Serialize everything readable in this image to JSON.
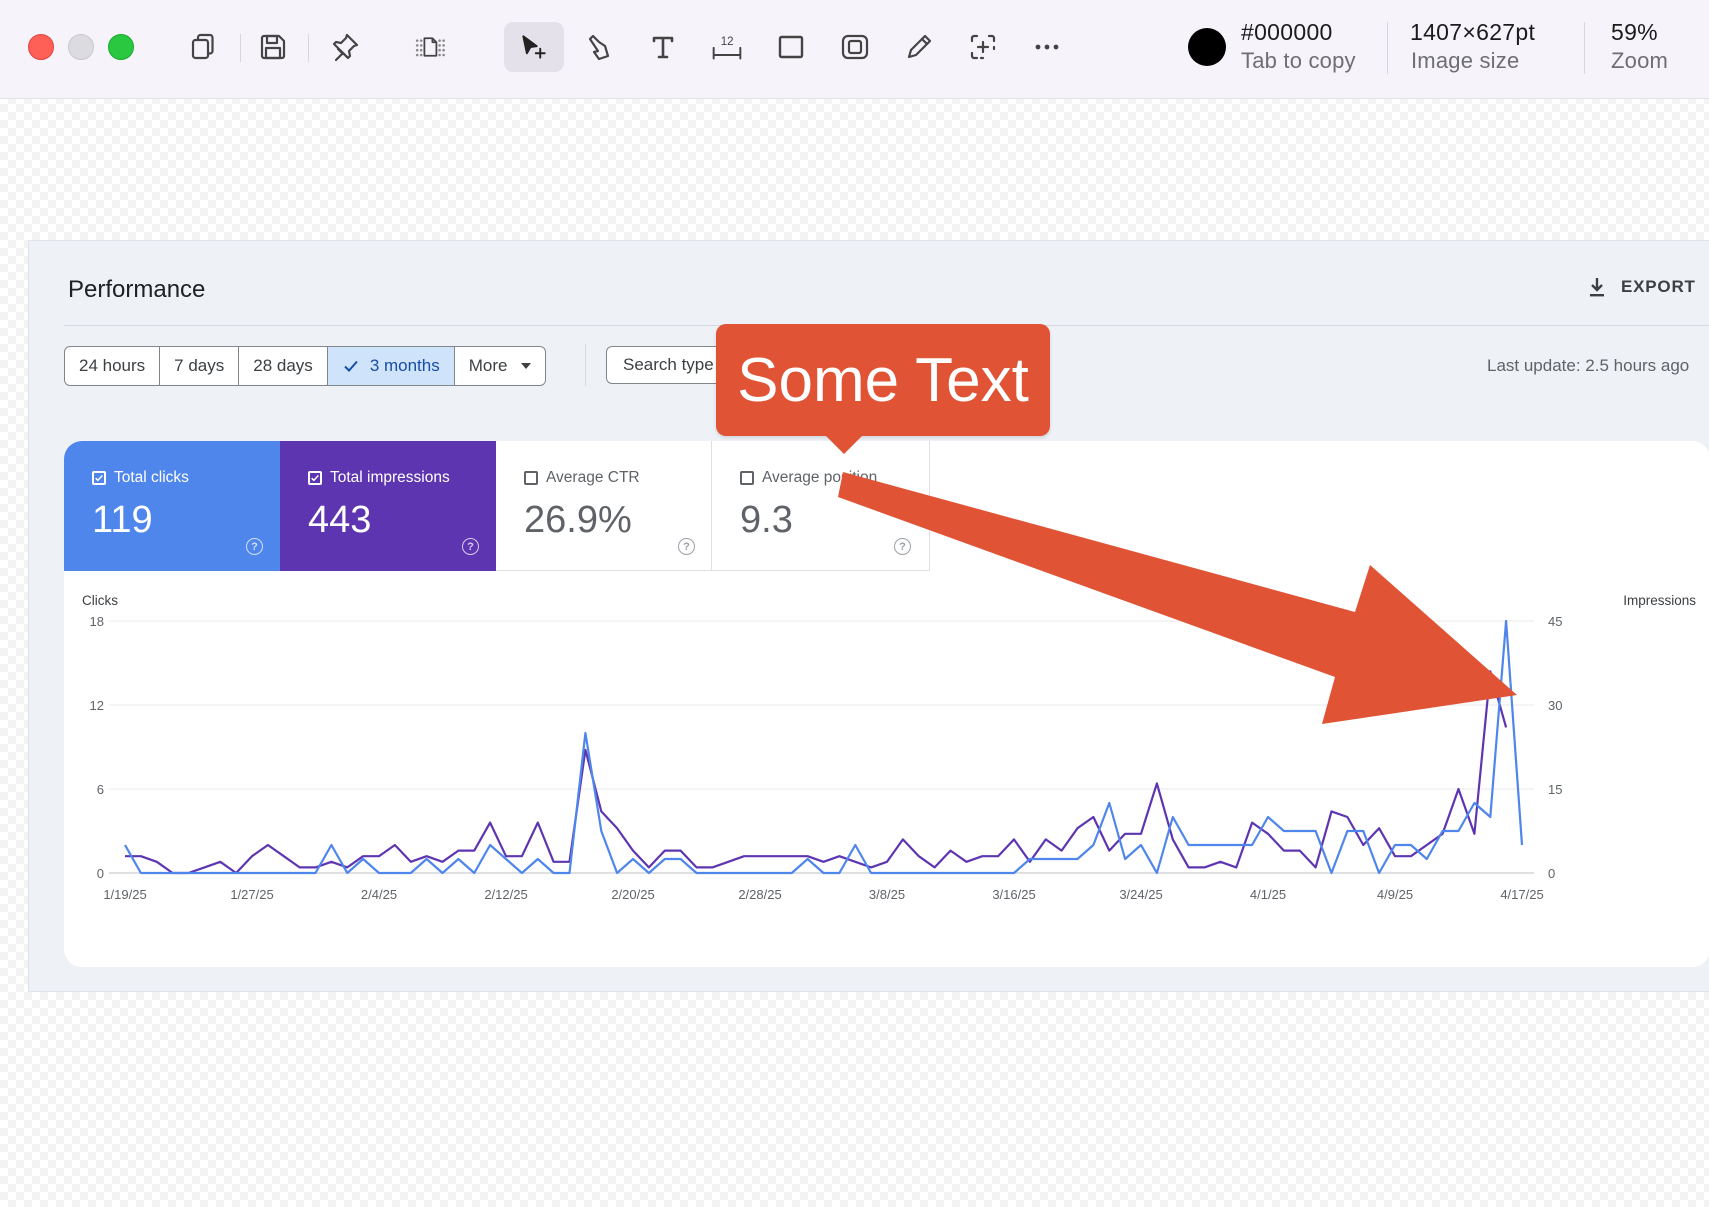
{
  "toolbar": {
    "icons": [
      "copy-icon",
      "save-icon",
      "pin-icon",
      "page-layout-icon",
      "select-cursor-icon",
      "hand-icon",
      "text-icon",
      "measure-icon",
      "rectangle-icon",
      "capture-icon",
      "pencil-icon",
      "add-frame-icon",
      "more-icon"
    ],
    "color": {
      "hex": "#000000",
      "value": "#000000",
      "label": "Tab to copy"
    },
    "image_size": {
      "value": "1407×627pt",
      "label": "Image size"
    },
    "zoom": {
      "value": "59%",
      "label": "Zoom"
    }
  },
  "panel": {
    "title": "Performance",
    "export_label": "EXPORT",
    "ranges": [
      "24 hours",
      "7 days",
      "28 days",
      "3 months",
      "More"
    ],
    "selected_range": "3 months",
    "search_type": "Search type",
    "last_update": "Last update: 2.5 hours ago",
    "metrics": {
      "clicks": {
        "label": "Total clicks",
        "value": "119",
        "checked": true,
        "color": "#4f86ec"
      },
      "impressions": {
        "label": "Total impressions",
        "value": "443",
        "checked": true,
        "color": "#5e35b1"
      },
      "ctr": {
        "label": "Average CTR",
        "value": "26.9%",
        "checked": false
      },
      "position": {
        "label": "Average position",
        "value": "9.3",
        "checked": false
      }
    }
  },
  "annotation": {
    "callout_text": "Some Text",
    "color": "#e05335"
  },
  "chart_data": {
    "type": "line",
    "left_axis": {
      "title": "Clicks",
      "ticks": [
        0,
        6,
        12,
        18
      ],
      "range": [
        0,
        18
      ]
    },
    "right_axis": {
      "title": "Impressions",
      "ticks": [
        0,
        15,
        30,
        45
      ],
      "range": [
        0,
        45
      ]
    },
    "x_tick_labels": [
      "1/19/25",
      "1/27/25",
      "2/4/25",
      "2/12/25",
      "2/20/25",
      "2/28/25",
      "3/8/25",
      "3/16/25",
      "3/24/25",
      "4/1/25",
      "4/9/25",
      "4/17/25"
    ],
    "x_start_label": "1/19/25",
    "grid": true,
    "series": [
      {
        "name": "Total clicks",
        "axis": "left",
        "color": "#4f86ec",
        "values": [
          2,
          0,
          0,
          0,
          0,
          0,
          0,
          0,
          0,
          0,
          0,
          0,
          0,
          2,
          0,
          1,
          0,
          0,
          0,
          1,
          0,
          1,
          0,
          2,
          1,
          0,
          1,
          0,
          0,
          10,
          3,
          0,
          1,
          0,
          1,
          1,
          0,
          0,
          0,
          0,
          0,
          0,
          0,
          1,
          0,
          0,
          2,
          0,
          0,
          0,
          0,
          0,
          0,
          0,
          0,
          0,
          0,
          1,
          1,
          1,
          1,
          2,
          5,
          1,
          2,
          0,
          4,
          2,
          2,
          2,
          2,
          2,
          4,
          3,
          3,
          3,
          0,
          3,
          3,
          0,
          2,
          2,
          1,
          3,
          3,
          5,
          4,
          18,
          2
        ]
      },
      {
        "name": "Total impressions",
        "axis": "right",
        "color": "#5e35b1",
        "values": [
          3,
          3,
          2,
          0,
          0,
          1,
          2,
          0,
          3,
          5,
          3,
          1,
          1,
          2,
          1,
          3,
          3,
          5,
          2,
          3,
          2,
          4,
          4,
          9,
          3,
          3,
          9,
          2,
          2,
          22,
          11,
          8,
          4,
          1,
          4,
          4,
          1,
          1,
          2,
          3,
          3,
          3,
          3,
          3,
          2,
          3,
          2,
          1,
          2,
          6,
          3,
          1,
          4,
          2,
          3,
          3,
          6,
          2,
          6,
          4,
          8,
          10,
          4,
          7,
          7,
          16,
          6,
          1,
          1,
          2,
          1,
          9,
          7,
          4,
          4,
          1,
          11,
          10,
          5,
          8,
          3,
          3,
          5,
          7,
          15,
          7,
          36,
          26
        ]
      }
    ]
  }
}
